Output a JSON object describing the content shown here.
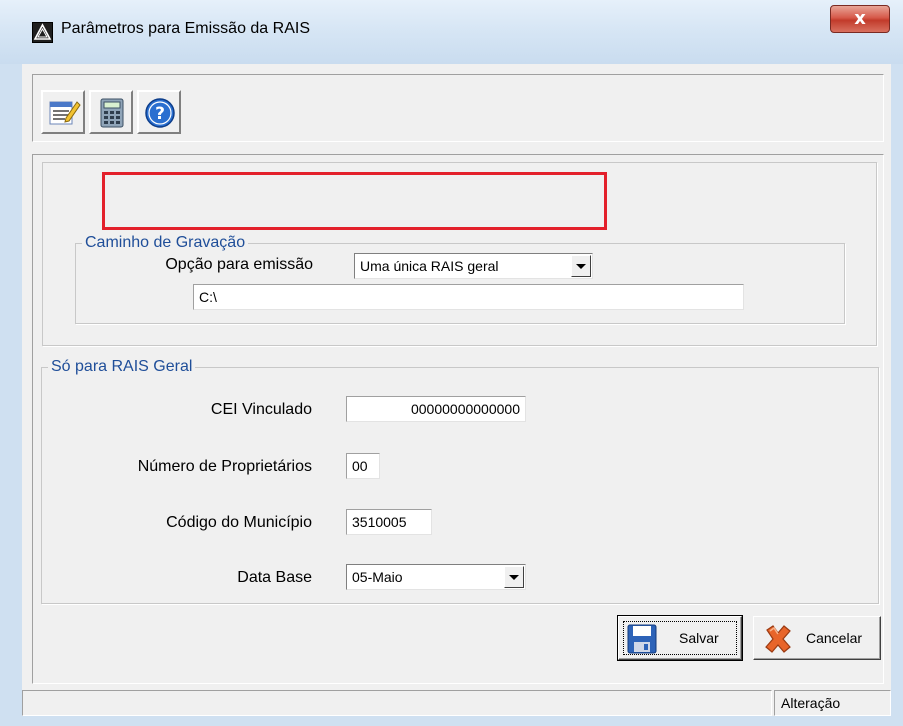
{
  "window": {
    "title": "Parâmetros para Emissão da RAIS",
    "close_label": "x"
  },
  "toolbar": {
    "buttons": [
      {
        "icon": "edit-notes-icon"
      },
      {
        "icon": "calculator-icon"
      },
      {
        "icon": "help-icon"
      }
    ]
  },
  "emission": {
    "option_label": "Opção para emissão",
    "option_value": "Uma única RAIS geral",
    "path_group_label": "Caminho de Gravação",
    "path_value": "C:\\"
  },
  "rais_geral": {
    "group_label": "Só para RAIS Geral",
    "cei_label": "CEI Vinculado",
    "cei_value": "00000000000000",
    "owners_label": "Número de Proprietários",
    "owners_value": "00",
    "municipio_label": "Código do Município",
    "municipio_value": "3510005",
    "database_label": "Data Base",
    "database_value": "05-Maio"
  },
  "actions": {
    "save_label": "Salvar",
    "cancel_label": "Cancelar"
  },
  "status": {
    "mode": "Alteração"
  },
  "colors": {
    "highlight": "#e3202b",
    "group_caption": "#1f4e99",
    "window_frame": "#cfe0f1"
  }
}
